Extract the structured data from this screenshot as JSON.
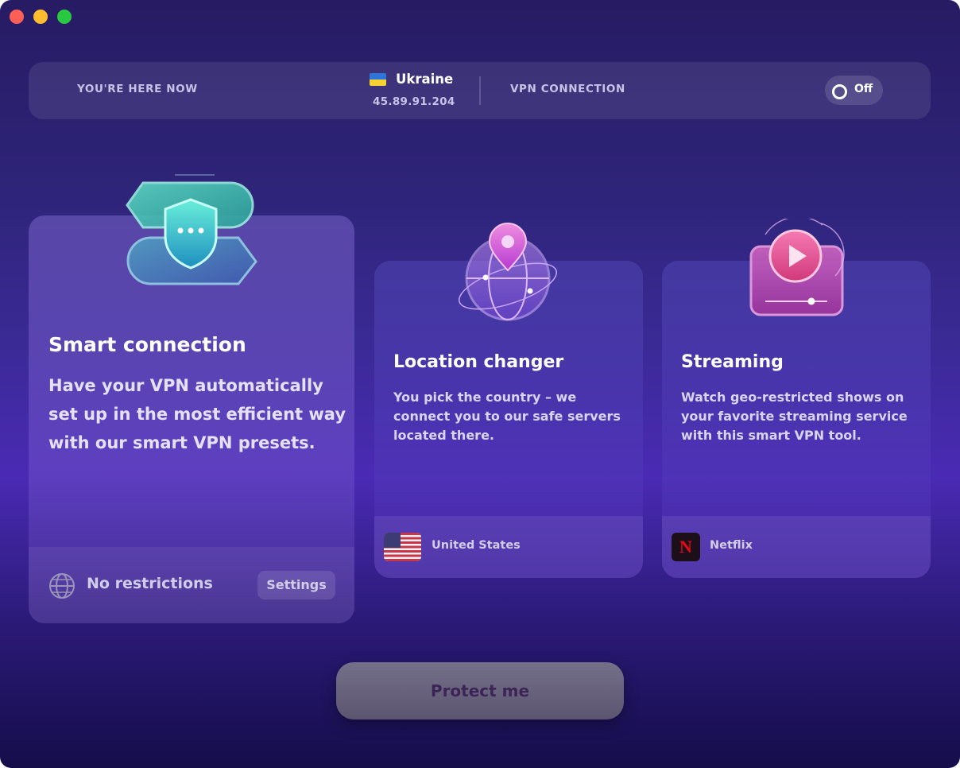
{
  "topbar": {
    "here_label": "YOU'RE HERE NOW",
    "country": "Ukraine",
    "ip": "45.89.91.204",
    "vpn_label": "VPN CONNECTION",
    "toggle_label": "Off"
  },
  "cards": {
    "smart": {
      "title": "Smart connection",
      "description": "Have your VPN automatically set up in the most efficient way with our smart VPN presets.",
      "footer_text": "No restrictions",
      "settings_label": "Settings",
      "icon": "shield-icon"
    },
    "location": {
      "title": "Location changer",
      "description": "You pick the country – we connect you to our safe servers located there.",
      "footer_text": "United States",
      "icon": "globe-pin-icon"
    },
    "streaming": {
      "title": "Streaming",
      "description": "Watch geo-restricted shows on your favorite streaming service with this smart VPN tool.",
      "footer_text": "Netflix",
      "icon": "play-icon"
    }
  },
  "protect_button": "Protect me",
  "colors": {
    "accent_pink": "#e0509b",
    "accent_teal": "#42d6c4",
    "background_top": "#271b63",
    "background_mid": "#4a2ab4"
  }
}
